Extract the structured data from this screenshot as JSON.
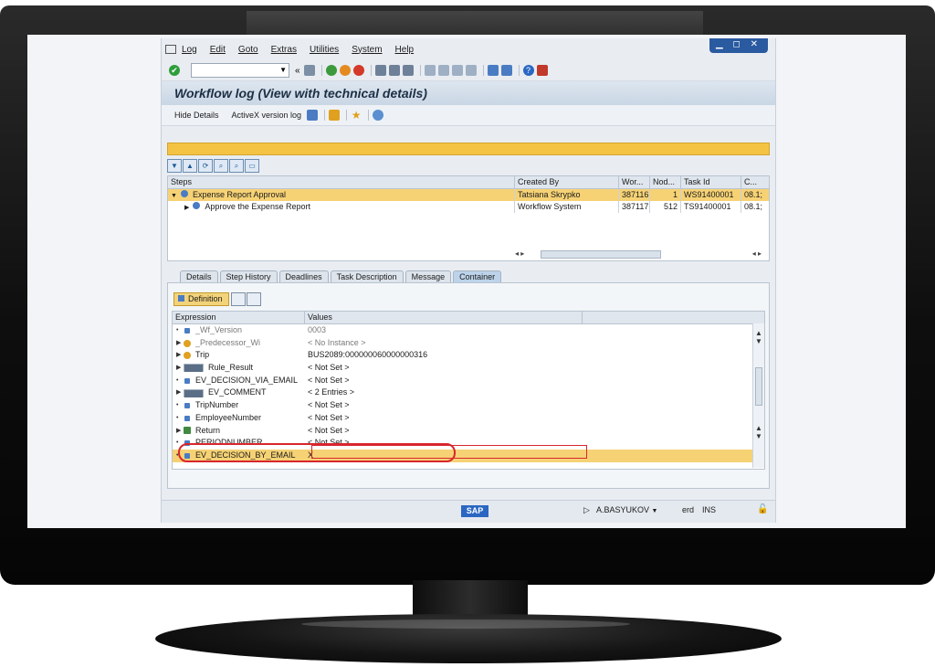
{
  "menu": {
    "items": [
      "Log",
      "Edit",
      "Goto",
      "Extras",
      "Utilities",
      "System",
      "Help"
    ]
  },
  "window_controls": "▁ ◻ ✕",
  "toolbar": {
    "back_glyph": "«"
  },
  "title": "Workflow log (View with technical details)",
  "app_toolbar": {
    "hide_details": "Hide Details",
    "activex_log": "ActiveX version log"
  },
  "steps_table": {
    "columns": [
      "Steps",
      "Created By",
      "Wor...",
      "Nod...",
      "Task Id",
      "C..."
    ],
    "rows": [
      {
        "step": "Expense Report Approval",
        "created_by": "Tatsiana Skrypko",
        "work_item": "387116",
        "node": "1",
        "task_id": "WS91400001",
        "c": "08.1;",
        "selected": true
      },
      {
        "step": "Approve the Expense Report",
        "created_by": "Workflow System",
        "work_item": "387117",
        "node": "512",
        "task_id": "TS91400001",
        "c": "08.1;",
        "selected": false
      }
    ]
  },
  "tabs": [
    "Details",
    "Step History",
    "Deadlines",
    "Task Description",
    "Message",
    "Container"
  ],
  "active_tab": "Container",
  "definition_label": "Definition",
  "container_table": {
    "columns": [
      "Expression",
      "Values"
    ],
    "rows": [
      {
        "expression": "_Wf_Version",
        "value": "0003",
        "icon": "element-icon",
        "expandable": false,
        "dim": true
      },
      {
        "expression": "_Predecessor_Wi",
        "value": "< No Instance >",
        "icon": "object-icon",
        "expandable": true,
        "dim": true
      },
      {
        "expression": "Trip",
        "value": "BUS2089:000000060000000316",
        "icon": "object-icon",
        "expandable": true,
        "dim": false
      },
      {
        "expression": "Rule_Result",
        "value": "< Not Set >",
        "icon": "table-icon",
        "expandable": true,
        "dim": false
      },
      {
        "expression": "EV_DECISION_VIA_EMAIL",
        "value": "< Not Set >",
        "icon": "element-icon",
        "expandable": false,
        "dim": false
      },
      {
        "expression": "EV_COMMENT",
        "value": "< 2 Entries >",
        "icon": "table-icon",
        "expandable": true,
        "dim": false
      },
      {
        "expression": "TripNumber",
        "value": "< Not Set >",
        "icon": "element-icon",
        "expandable": false,
        "dim": false
      },
      {
        "expression": "EmployeeNumber",
        "value": "< Not Set >",
        "icon": "element-icon",
        "expandable": false,
        "dim": false
      },
      {
        "expression": "Return",
        "value": "< Not Set >",
        "icon": "structure-icon",
        "expandable": true,
        "dim": false
      },
      {
        "expression": "PERIODNUMBER",
        "value": "< Not Set >",
        "icon": "element-icon",
        "expandable": false,
        "dim": false
      },
      {
        "expression": "EV_DECISION_BY_EMAIL",
        "value": "X",
        "icon": "element-icon",
        "expandable": false,
        "dim": false,
        "highlighted": true
      }
    ]
  },
  "status_bar": {
    "sap_logo": "SAP",
    "user": "A.BASYUKOV",
    "system": "erd",
    "mode": "INS"
  },
  "colors": {
    "highlight": "#f6d275",
    "message_bar": "#f5c343",
    "annotation_circle": "#d8262d"
  }
}
